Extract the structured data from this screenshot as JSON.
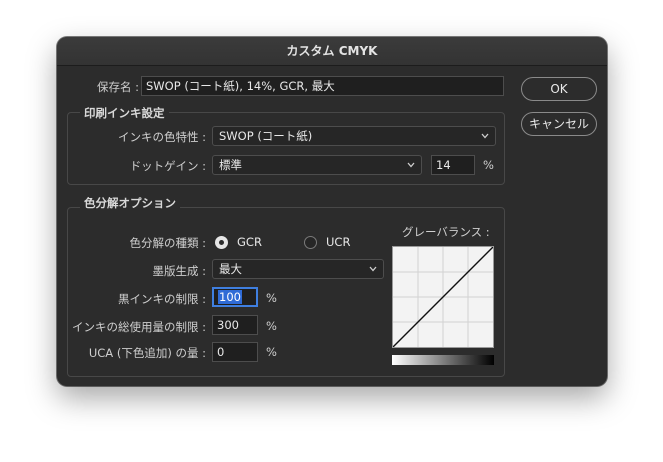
{
  "dialog": {
    "title": "カスタム CMYK",
    "name_label": "保存名 :",
    "name_value": "SWOP (コート紙), 14%, GCR, 最大",
    "ok_label": "OK",
    "cancel_label": "キャンセル"
  },
  "ink_options": {
    "title": "印刷インキ設定",
    "ink_colors_label": "インキの色特性 :",
    "ink_colors_value": "SWOP (コート紙)",
    "dot_gain_label": "ドットゲイン :",
    "dot_gain_value": "標準",
    "dot_gain_amount": "14",
    "dot_gain_unit": "%"
  },
  "separation_options": {
    "title": "色分解オプション",
    "type_label": "色分解の種類 :",
    "type_options": [
      "GCR",
      "UCR"
    ],
    "type_selected": "GCR",
    "black_gen_label": "墨版生成 :",
    "black_gen_value": "最大",
    "black_limit_label": "黒インキの制限 :",
    "black_limit_value": "100",
    "total_ink_label": "インキの総使用量の制限 :",
    "total_ink_value": "300",
    "uca_label": "UCA (下色追加) の量 :",
    "uca_value": "0",
    "unit": "%",
    "gray_ramp_label": "グレーバランス :"
  },
  "icons": {
    "dropdown": "chevron-down-icon",
    "radio_on": "radio-selected-icon",
    "radio_off": "radio-unselected-icon"
  },
  "colors": {
    "background": "#2c2c2c",
    "focus": "#3f7fe0",
    "selection": "#2f6bd6"
  }
}
